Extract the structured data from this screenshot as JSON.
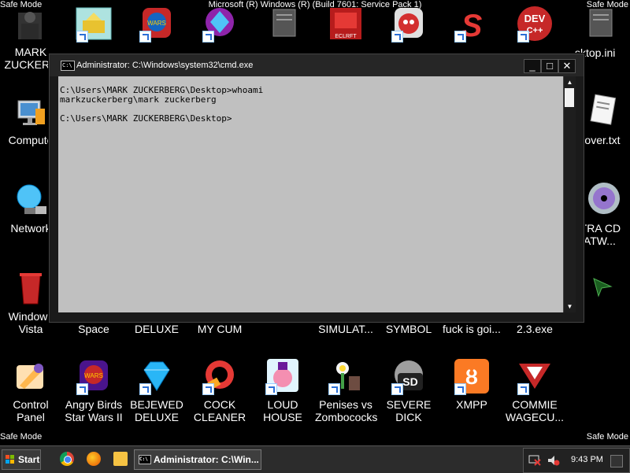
{
  "banner": "Microsoft (R) Windows (R) (Build 7601: Service Pack 1)",
  "watermark": {
    "top_left": "Safe Mode",
    "top_right": "Safe Mode",
    "bottom_left": "Safe Mode",
    "bottom_right": "Safe Mode"
  },
  "desktop": {
    "left_column": [
      {
        "label": "MARK\nZUCKERB",
        "icon": "user-folder-icon"
      },
      {
        "label": "Compute",
        "icon": "computer-icon"
      },
      {
        "label": "Network",
        "icon": "network-icon"
      },
      {
        "label": "Windows\nVista",
        "icon": "recycle-bin-icon"
      }
    ],
    "top_row": [
      {
        "icon": "folder-shortcut-icon"
      },
      {
        "icon": "angry-birds-star-wars-icon"
      },
      {
        "icon": "bejeweled-icon"
      },
      {
        "icon": "document-icon"
      },
      {
        "icon": "document-icon"
      },
      {
        "icon": "eclairt-icon"
      },
      {
        "icon": "angry-birds-icon"
      },
      {
        "icon": "s-logo-icon"
      },
      {
        "icon": "dev-cpp-icon"
      },
      {
        "icon": "document-icon"
      }
    ],
    "right_column": [
      {
        "label": "sktop.ini",
        "icon": "settings-file-icon"
      },
      {
        "label": "over.txt",
        "icon": "text-file-icon"
      },
      {
        "label": "LTRA CD\nOATW...",
        "icon": "cd-icon"
      },
      {
        "label": "",
        "icon": "cursor-icon"
      }
    ],
    "middle_row_labels": [
      "Space",
      "DELUXE",
      "MY CUM",
      "SIMULAT...",
      "SYMBOL",
      "fuck is goi...",
      "2.3.exe"
    ],
    "bottom_row": [
      {
        "label": "Control\nPanel",
        "icon": "control-panel-icon"
      },
      {
        "label": "Angry Birds\nStar Wars II",
        "icon": "angry-birds-star-wars-icon"
      },
      {
        "label": "BEJEWED\nDELUXE",
        "icon": "gem-icon"
      },
      {
        "label": "COCK\nCLEANER",
        "icon": "ccleaner-icon"
      },
      {
        "label": "LOUD\nHOUSE",
        "icon": "loud-house-icon"
      },
      {
        "label": "Penises vs\nZombococks",
        "icon": "plants-vs-zombies-icon"
      },
      {
        "label": "SEVERE\nDICK",
        "icon": "sd-drive-icon"
      },
      {
        "label": "XMPP",
        "icon": "xampp-icon"
      },
      {
        "label": "COMMIE\nWAGECU...",
        "icon": "commie-icon"
      }
    ]
  },
  "cmd": {
    "title": "Administrator: C:\\Windows\\system32\\cmd.exe",
    "icon_text": "C:\\",
    "minimize": "_",
    "maximize": "□",
    "close": "✕",
    "scroll_up": "▲",
    "scroll_down": "▼",
    "output": "C:\\Users\\MARK ZUCKERBERG\\Desktop>whoami\nmarkzuckerberg\\mark zuckerberg\n\nC:\\Users\\MARK ZUCKERBERG\\Desktop>"
  },
  "taskbar": {
    "start_label": "Start",
    "task_button": "Administrator: C:\\Win...",
    "task_icon_text": "C:\\",
    "clock": "9:43 PM"
  }
}
